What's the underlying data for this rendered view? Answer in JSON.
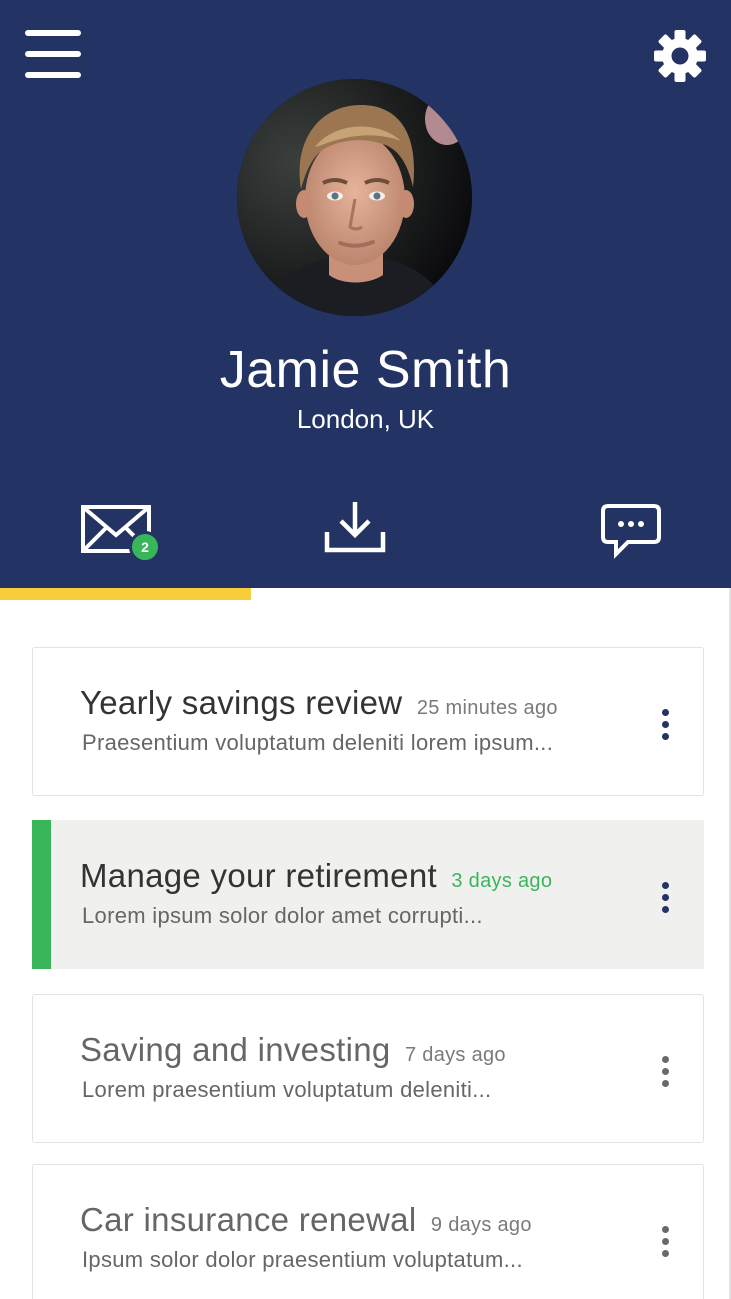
{
  "profile": {
    "name": "Jamie Smith",
    "location": "London, UK"
  },
  "header_icons": {
    "menu": "hamburger-menu-icon",
    "settings": "gear-icon"
  },
  "tabs": [
    {
      "icon": "envelope-icon",
      "badge": "2",
      "active": true
    },
    {
      "icon": "download-icon",
      "active": false
    },
    {
      "icon": "chat-bubble-icon",
      "active": false
    }
  ],
  "colors": {
    "header_bg": "#233464",
    "active_tab_indicator": "#f8cd3c",
    "unread_green": "#3ab65a"
  },
  "messages": [
    {
      "title": "Yearly savings review",
      "time": "25 minutes ago",
      "preview": "Praesentium voluptatum deleniti lorem ipsum...",
      "state": "read"
    },
    {
      "title": "Manage your retirement",
      "time": "3 days ago",
      "preview": "Lorem ipsum solor dolor amet corrupti...",
      "state": "selected"
    },
    {
      "title": "Saving and investing",
      "time": "7 days ago",
      "preview": "Lorem praesentium voluptatum deleniti...",
      "state": "muted"
    },
    {
      "title": "Car insurance renewal",
      "time": "9 days ago",
      "preview": "Ipsum solor dolor praesentium voluptatum...",
      "state": "muted"
    }
  ]
}
